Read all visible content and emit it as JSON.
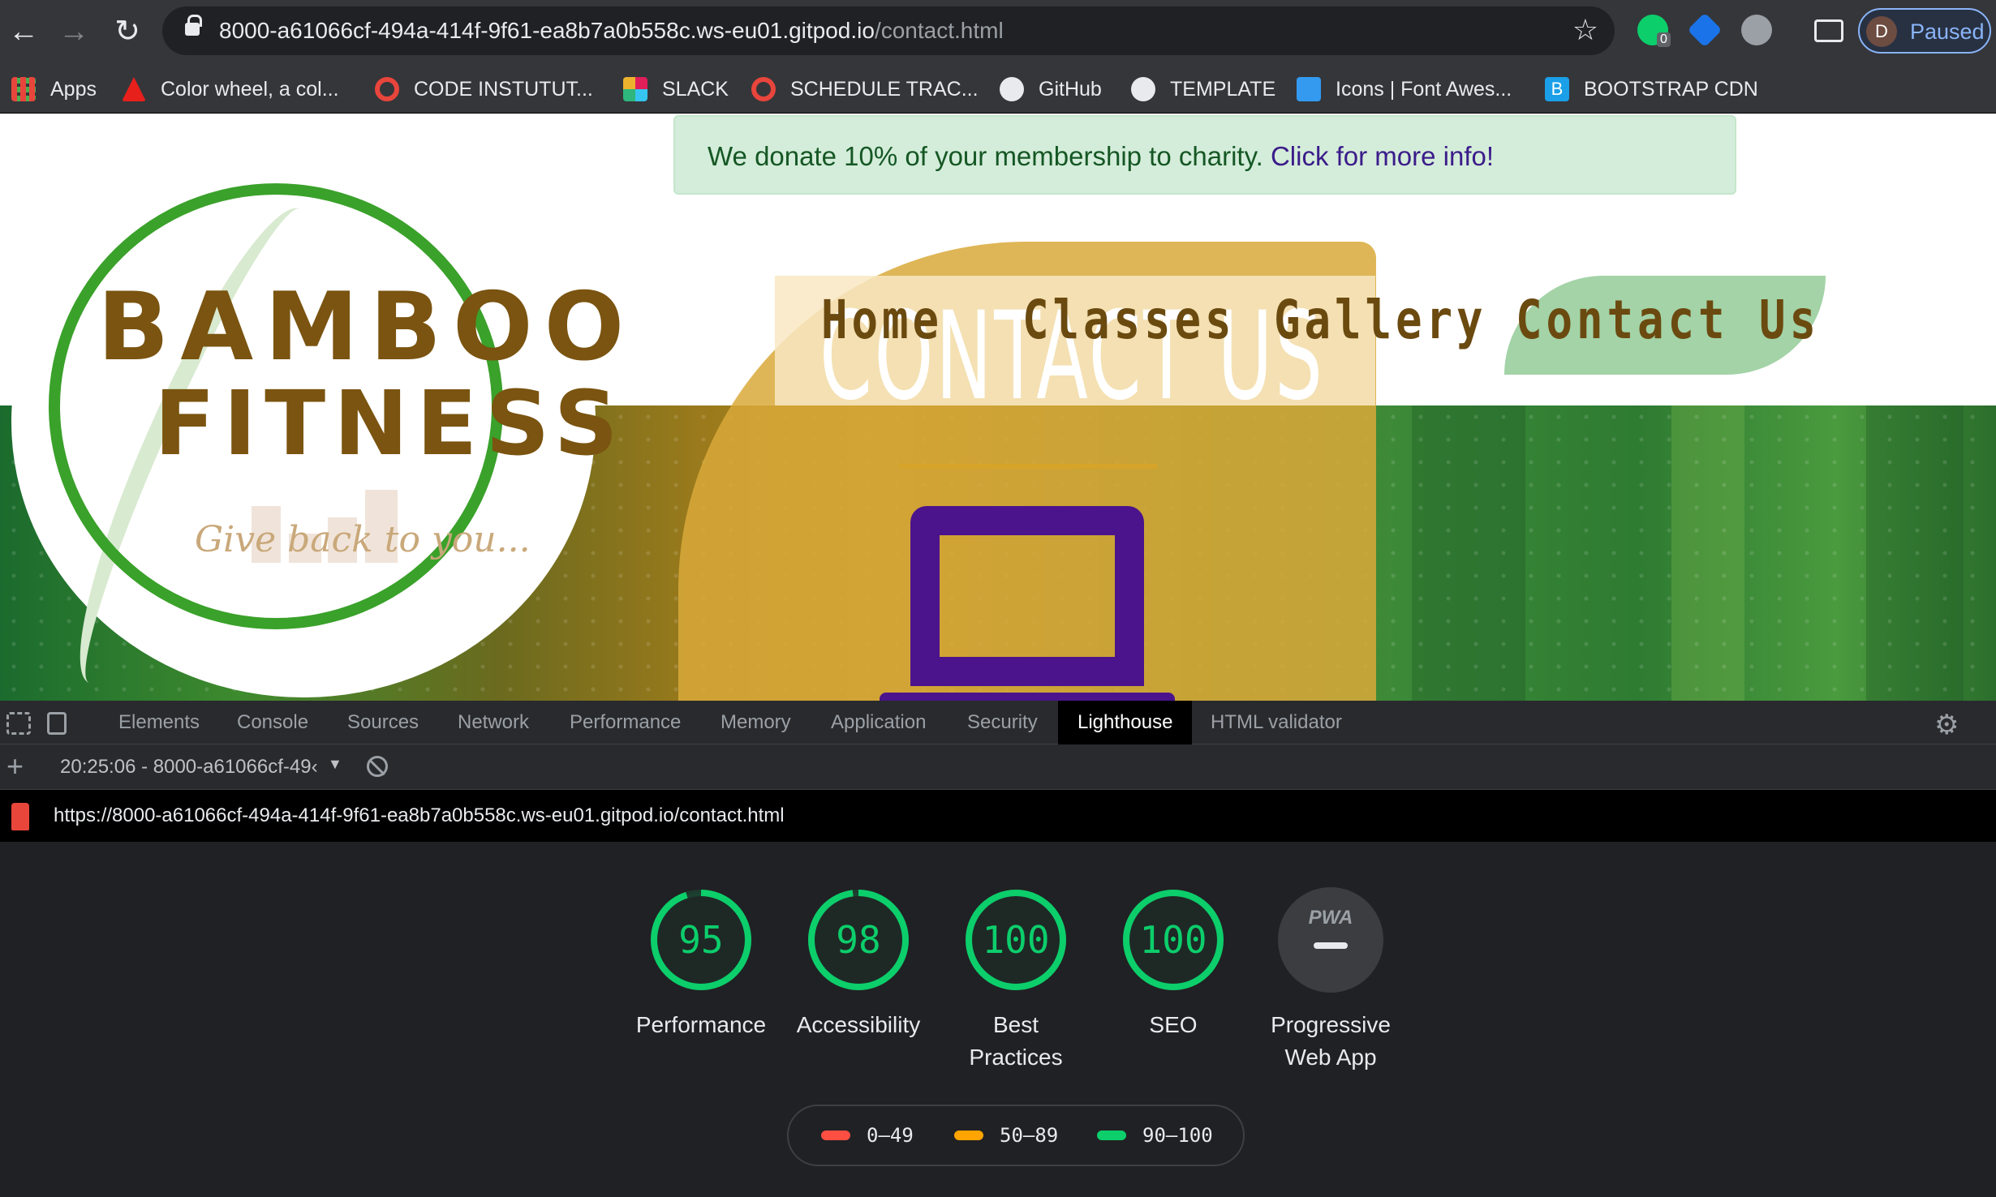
{
  "browser": {
    "url_main": "8000-a61066cf-494a-414f-9f61-ea8b7a0b558c.ws-eu01.gitpod.io",
    "url_path": "/contact.html",
    "ext_badge": "0",
    "profile_initial": "D",
    "profile_status": "Paused"
  },
  "bookmarks": [
    {
      "label": "Apps",
      "icon": "apps-grid-icon",
      "color": "#e8453c"
    },
    {
      "label": "Color wheel, a col...",
      "icon": "adobe-icon",
      "color": "#e8201c"
    },
    {
      "label": "CODE INSTUTUT...",
      "icon": "code-institute-icon",
      "color": "#e8453c"
    },
    {
      "label": "SLACK",
      "icon": "slack-icon",
      "color": "#9b59b6"
    },
    {
      "label": "SCHEDULE TRAC...",
      "icon": "schedule-icon",
      "color": "#e8453c"
    },
    {
      "label": "GitHub",
      "icon": "github-icon",
      "color": "#e8eaed"
    },
    {
      "label": "TEMPLATE",
      "icon": "github-icon",
      "color": "#e8eaed"
    },
    {
      "label": "Icons | Font Awes...",
      "icon": "font-awesome-flag-icon",
      "color": "#339af0"
    },
    {
      "label": "BOOTSTRAP CDN",
      "icon": "bootstrap-icon",
      "color": "#1a9fe8"
    }
  ],
  "site": {
    "alert_text": "We donate 10% of your membership to charity.",
    "alert_link": "Click for more info!",
    "logo_line1": "BAMBOO",
    "logo_line2": "FITNESS",
    "tagline": "Give back to you...",
    "hero_title": "CONTACT US",
    "nav": [
      "Home",
      "Classes",
      "Gallery",
      "Contact Us"
    ],
    "colors": {
      "brand_brown": "#7a5410",
      "brand_green": "#3aa12a",
      "accent_purple": "#4b148c",
      "gold": "#d6a429"
    }
  },
  "devtools": {
    "tabs": [
      "Elements",
      "Console",
      "Sources",
      "Network",
      "Performance",
      "Memory",
      "Application",
      "Security",
      "Lighthouse",
      "HTML validator"
    ],
    "active_tab": "Lighthouse",
    "report_label": "20:25:06 - 8000-a61066cf-49‹",
    "report_url": "https://8000-a61066cf-494a-414f-9f61-ea8b7a0b558c.ws-eu01.gitpod.io/contact.html"
  },
  "lighthouse": {
    "scores": [
      {
        "label_line1": "Performance",
        "label_line2": "",
        "score": "95",
        "fraction": 0.95
      },
      {
        "label_line1": "Accessibility",
        "label_line2": "",
        "score": "98",
        "fraction": 0.98
      },
      {
        "label_line1": "Best",
        "label_line2": "Practices",
        "score": "100",
        "fraction": 1.0
      },
      {
        "label_line1": "SEO",
        "label_line2": "",
        "score": "100",
        "fraction": 1.0
      }
    ],
    "pwa": {
      "badge": "PWA",
      "label_line1": "Progressive",
      "label_line2": "Web App"
    },
    "legend": [
      {
        "range": "0–49",
        "color": "#ff4e42"
      },
      {
        "range": "50–89",
        "color": "#ffa400"
      },
      {
        "range": "90–100",
        "color": "#0cce6b"
      }
    ],
    "pass_color": "#0cce6b"
  }
}
